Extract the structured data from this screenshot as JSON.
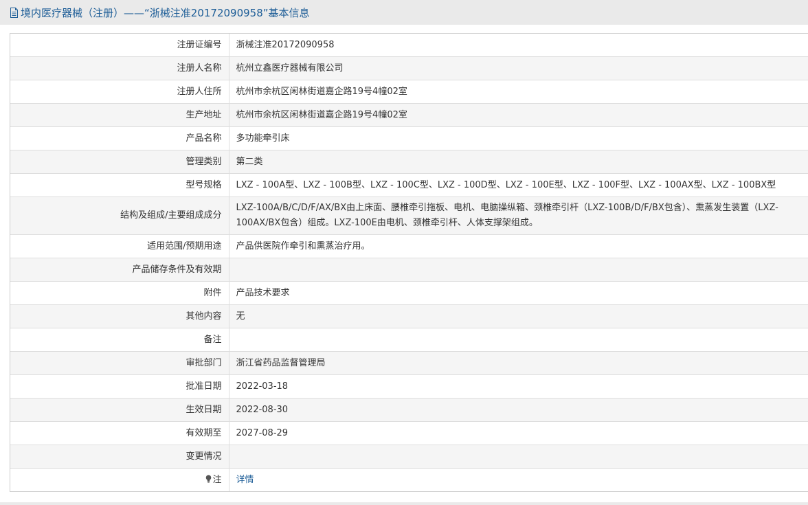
{
  "header": {
    "title": "境内医疗器械（注册）——“浙械注准20172090958”基本信息",
    "icon": "document-icon"
  },
  "rows": [
    {
      "label": "注册证编号",
      "value": "浙械注准20172090958"
    },
    {
      "label": "注册人名称",
      "value": "杭州立鑫医疗器械有限公司"
    },
    {
      "label": "注册人住所",
      "value": "杭州市余杭区闲林街道嘉企路19号4幢02室"
    },
    {
      "label": "生产地址",
      "value": "杭州市余杭区闲林街道嘉企路19号4幢02室"
    },
    {
      "label": "产品名称",
      "value": "多功能牵引床"
    },
    {
      "label": "管理类别",
      "value": "第二类"
    },
    {
      "label": "型号规格",
      "value": "LXZ - 100A型、LXZ - 100B型、LXZ - 100C型、LXZ - 100D型、LXZ - 100E型、LXZ - 100F型、LXZ - 100AX型、LXZ - 100BX型"
    },
    {
      "label": "结构及组成/主要组成成分",
      "value": "LXZ-100A/B/C/D/F/AX/BX由上床面、腰椎牵引拖板、电机、电脑操纵箱、颈椎牵引杆（LXZ-100B/D/F/BX包含）、熏蒸发生装置（LXZ-100AX/BX包含）组成。LXZ-100E由电机、颈椎牵引杆、人体支撑架组成。"
    },
    {
      "label": "适用范围/预期用途",
      "value": "产品供医院作牵引和熏蒸治疗用。"
    },
    {
      "label": "产品储存条件及有效期",
      "value": ""
    },
    {
      "label": "附件",
      "value": "产品技术要求"
    },
    {
      "label": "其他内容",
      "value": "无"
    },
    {
      "label": "备注",
      "value": ""
    },
    {
      "label": "审批部门",
      "value": "浙江省药品监督管理局"
    },
    {
      "label": "批准日期",
      "value": "2022-03-18"
    },
    {
      "label": "生效日期",
      "value": "2022-08-30"
    },
    {
      "label": "有效期至",
      "value": "2027-08-29"
    },
    {
      "label": "变更情况",
      "value": ""
    }
  ],
  "note": {
    "label": "注",
    "icon": "lightbulb-icon",
    "link_text": "详情"
  },
  "colors": {
    "header_bg": "#eaeaea",
    "header_text": "#1d5d97",
    "row_alt_bg": "#f5f5f5",
    "link": "#1d5d97"
  }
}
